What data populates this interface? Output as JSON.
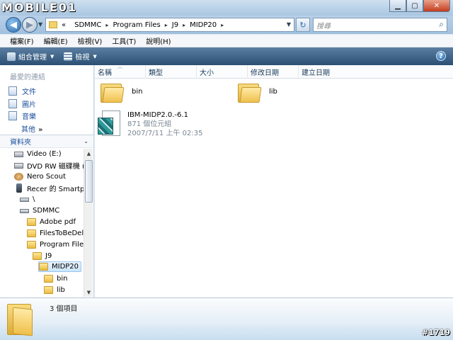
{
  "watermark": "MOBILE01",
  "address": {
    "crumbs": [
      "«",
      "SDMMC",
      "Program Files",
      "J9",
      "MIDP20"
    ],
    "search_placeholder": "搜尋"
  },
  "menu": [
    "檔案(F)",
    "編輯(E)",
    "檢視(V)",
    "工具(T)",
    "說明(H)"
  ],
  "toolbar": {
    "organize": "組合管理",
    "views": "檢視"
  },
  "nav": {
    "favorites_header": "最愛的連結",
    "favorites": [
      "文件",
      "圖片",
      "音樂"
    ],
    "more": "其他",
    "folders_header": "資料夾",
    "tree": [
      "Video (E:)",
      "DVD RW 磁碟機 (I",
      "Nero Scout",
      "Recer 的 Smartph",
      "\\",
      "SDMMC",
      "Adobe pdf",
      "FilesToBeDele",
      "Program Files",
      "J9",
      "MIDP20",
      "bin",
      "lib"
    ]
  },
  "columns": [
    "名稱",
    "類型",
    "大小",
    "修改日期",
    "建立日期"
  ],
  "items": {
    "folder1": "bin",
    "folder2": "lib",
    "file": {
      "name": "IBM-MIDP2.0.-6.1",
      "size": "871 個位元組",
      "date": "2007/7/11 上午 02:35"
    }
  },
  "details": {
    "count": "3 個項目"
  },
  "corner_tag": "#1719"
}
